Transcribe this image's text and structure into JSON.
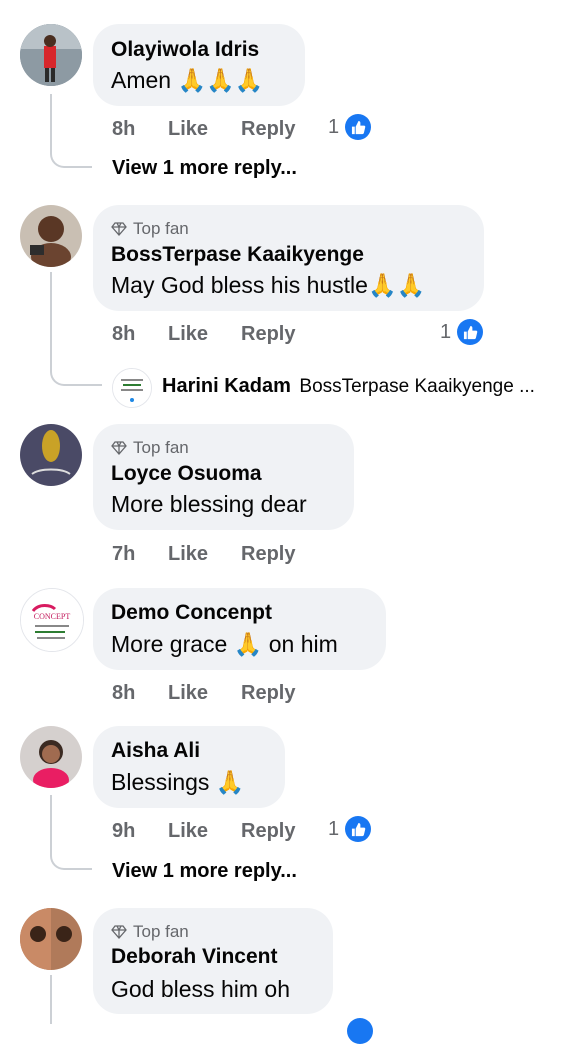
{
  "comments": [
    {
      "name": "Olayiwola Idris",
      "text": "Amen 🙏🙏🙏",
      "time": "8h",
      "like": "Like",
      "reply": "Reply",
      "reactions": "1",
      "view_more": "View 1 more reply..."
    },
    {
      "badge": "Top fan",
      "name": "BossTerpase Kaaikyenge",
      "text": "May God bless his hustle🙏🙏",
      "time": "8h",
      "like": "Like",
      "reply": "Reply",
      "reactions": "1",
      "reply_preview": {
        "name": "Harini Kadam",
        "text": "BossTerpase Kaaikyenge ..."
      }
    },
    {
      "badge": "Top fan",
      "name": "Loyce Osuoma",
      "text": "More blessing dear",
      "time": "7h",
      "like": "Like",
      "reply": "Reply"
    },
    {
      "name": "Demo Concenpt",
      "text": "More grace 🙏 on him",
      "time": "8h",
      "like": "Like",
      "reply": "Reply",
      "avatar_logo": "CONCEPT"
    },
    {
      "name": "Aisha Ali",
      "text": "Blessings 🙏",
      "time": "9h",
      "like": "Like",
      "reply": "Reply",
      "reactions": "1",
      "view_more": "View 1 more reply..."
    },
    {
      "badge": "Top fan",
      "name": "Deborah Vincent",
      "text": "God bless him oh"
    }
  ],
  "colors": {
    "bubble": "#f0f2f5",
    "meta": "#65676b",
    "like_blue": "#1877f2",
    "thread": "#ccd0d5"
  }
}
